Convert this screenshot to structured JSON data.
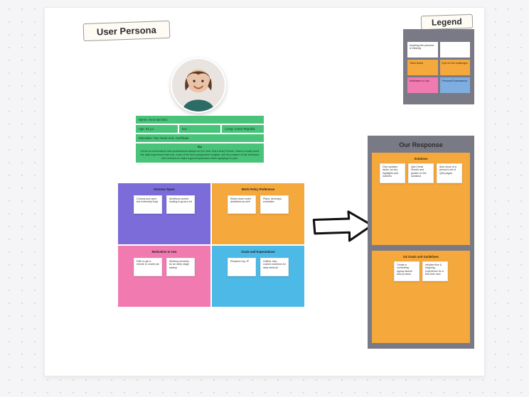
{
  "header": {
    "title": "User Persona"
  },
  "avatar": {
    "alt": "Persona photo"
  },
  "info": {
    "name_line": "Name: Anna Sanchez",
    "row": {
      "age": "Age: 34 y.o.",
      "sex": "Sex",
      "location": "Living: Czech Republic"
    },
    "education": "Education: Two Years Univ. Certificate",
    "bio_title": "Bio",
    "bio_text": "A free-of-conventions new professional always on the hunt. But a busy Person. Want to easily build the data experience she has, must of her time perspective insights, and life position of the feedback she receives to make a good impression when applying for jobs."
  },
  "quadrants": {
    "purple": {
      "title": "Persona Types",
      "notes": [
        "Curious and open but extremely busy",
        "Ambitious worker looking to grow a lot"
      ]
    },
    "orange": {
      "title": "Work Policy Preference",
      "notes": [
        "Works done under deadlines as well",
        "Plans, develops, evaluates"
      ]
    },
    "pink": {
      "title": "Motivation to Use",
      "notes": [
        "Path to get a remote or onsite job",
        "Working remotely for an early stage startup"
      ]
    },
    "blue": {
      "title": "Goals and Expectations",
      "notes": [
        "Requires reg. IP",
        "Unified, fast, custom solutions for data retrieval"
      ]
    }
  },
  "arrow": {
    "label": "leads-to"
  },
  "legend": {
    "title": "Legend",
    "items": [
      {
        "color": "white",
        "text": "Anything the persona is thinking"
      },
      {
        "color": "white",
        "text": ""
      },
      {
        "color": "orange",
        "text": "Team Notes"
      },
      {
        "color": "orange",
        "text": "Epic for the challenges"
      },
      {
        "color": "pink",
        "text": "Motivation to Use"
      },
      {
        "color": "blue",
        "text": "Personal Expectations"
      }
    ]
  },
  "response": {
    "title": "Our Response",
    "box1": {
      "subtitle": "Solutions",
      "notes": [
        "Give updates faster, as key highlights and markers",
        "Add Cheat Sheets and guides on the solutions",
        "Auto show of a person's set of Q&A pages"
      ]
    },
    "box2": {
      "subtitle": "UX Goals and Guidelines",
      "notes": [
        "Create a comforting signup launch flow process",
        "Intuitive flow & forgiving experience for a first-time user"
      ]
    }
  },
  "colors": {
    "green": "#4ac37a",
    "purple": "#7b6cd9",
    "orange": "#f5a83c",
    "pink": "#f17bb0",
    "blue": "#4db9e6",
    "panel": "#7a7a86"
  }
}
